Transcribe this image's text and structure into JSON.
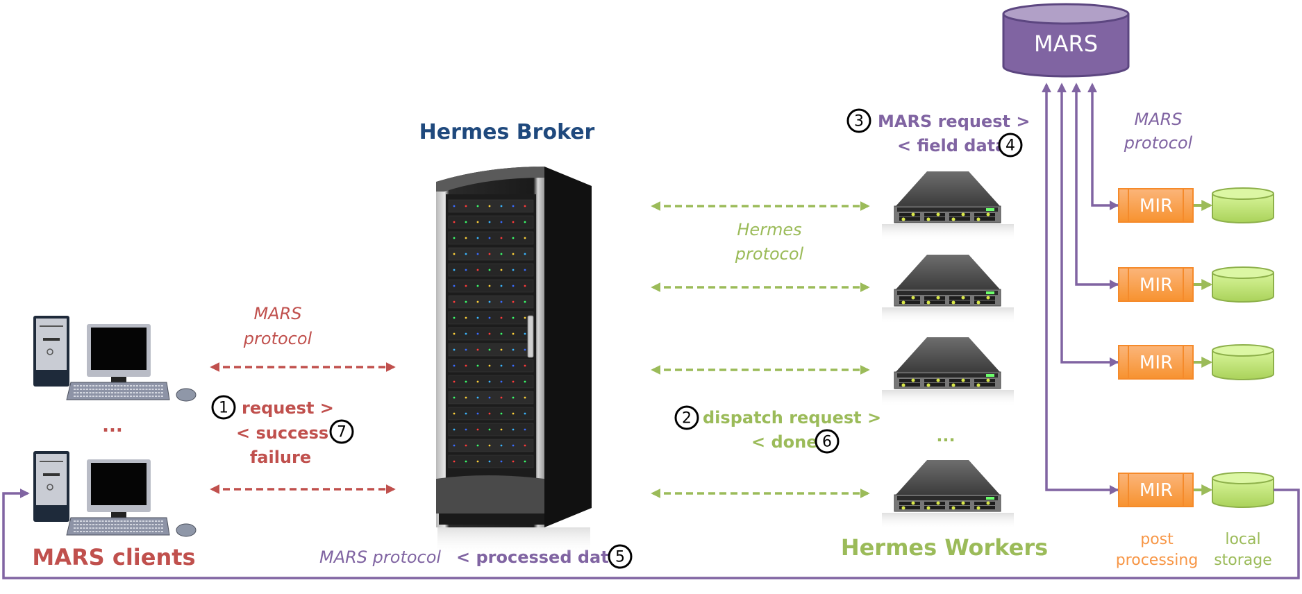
{
  "colors": {
    "mars_red": "#c0504d",
    "hermes_blue": "#1f497d",
    "hermes_green": "#9bbb59",
    "mars_purple": "#8064a2",
    "mir_orange": "#f79646",
    "storage_green": "#c4e37a",
    "black": "#000000"
  },
  "mars_db": {
    "label": "MARS",
    "icon": "database-cylinder-icon"
  },
  "broker": {
    "title": "Hermes Broker",
    "icon": "server-rack-icon"
  },
  "clients": {
    "title": "MARS clients",
    "ellipsis": "...",
    "icon": "desktop-computer-icon",
    "count_shown": 2
  },
  "workers": {
    "title": "Hermes Workers",
    "ellipsis": "...",
    "icon": "rack-server-unit-icon",
    "count_shown": 4
  },
  "client_broker_link": {
    "protocol_line1": "MARS",
    "protocol_line2": "protocol",
    "step1_number": "1",
    "step1_text": "request >",
    "step7_text_line1": "< success /",
    "step7_number": "7",
    "step7_text_line2": "failure"
  },
  "broker_worker_link": {
    "protocol_line1": "Hermes",
    "protocol_line2": "protocol",
    "step2_number": "2",
    "step2_text": "dispatch request >",
    "step6_text": "< done",
    "step6_number": "6"
  },
  "worker_mars_link": {
    "step3_number": "3",
    "step3_text": "MARS request >",
    "step4_text": "< field data",
    "step4_number": "4",
    "protocol_line1": "MARS",
    "protocol_line2": "protocol"
  },
  "mir_nodes": [
    {
      "label": "MIR"
    },
    {
      "label": "MIR"
    },
    {
      "label": "MIR"
    },
    {
      "label": "MIR"
    }
  ],
  "pipeline_labels": {
    "post_processing_line1": "post",
    "post_processing_line2": "processing",
    "local_storage_line1": "local",
    "local_storage_line2": "storage"
  },
  "return_link": {
    "protocol": "MARS protocol",
    "step5_text": "< processed data",
    "step5_number": "5"
  }
}
